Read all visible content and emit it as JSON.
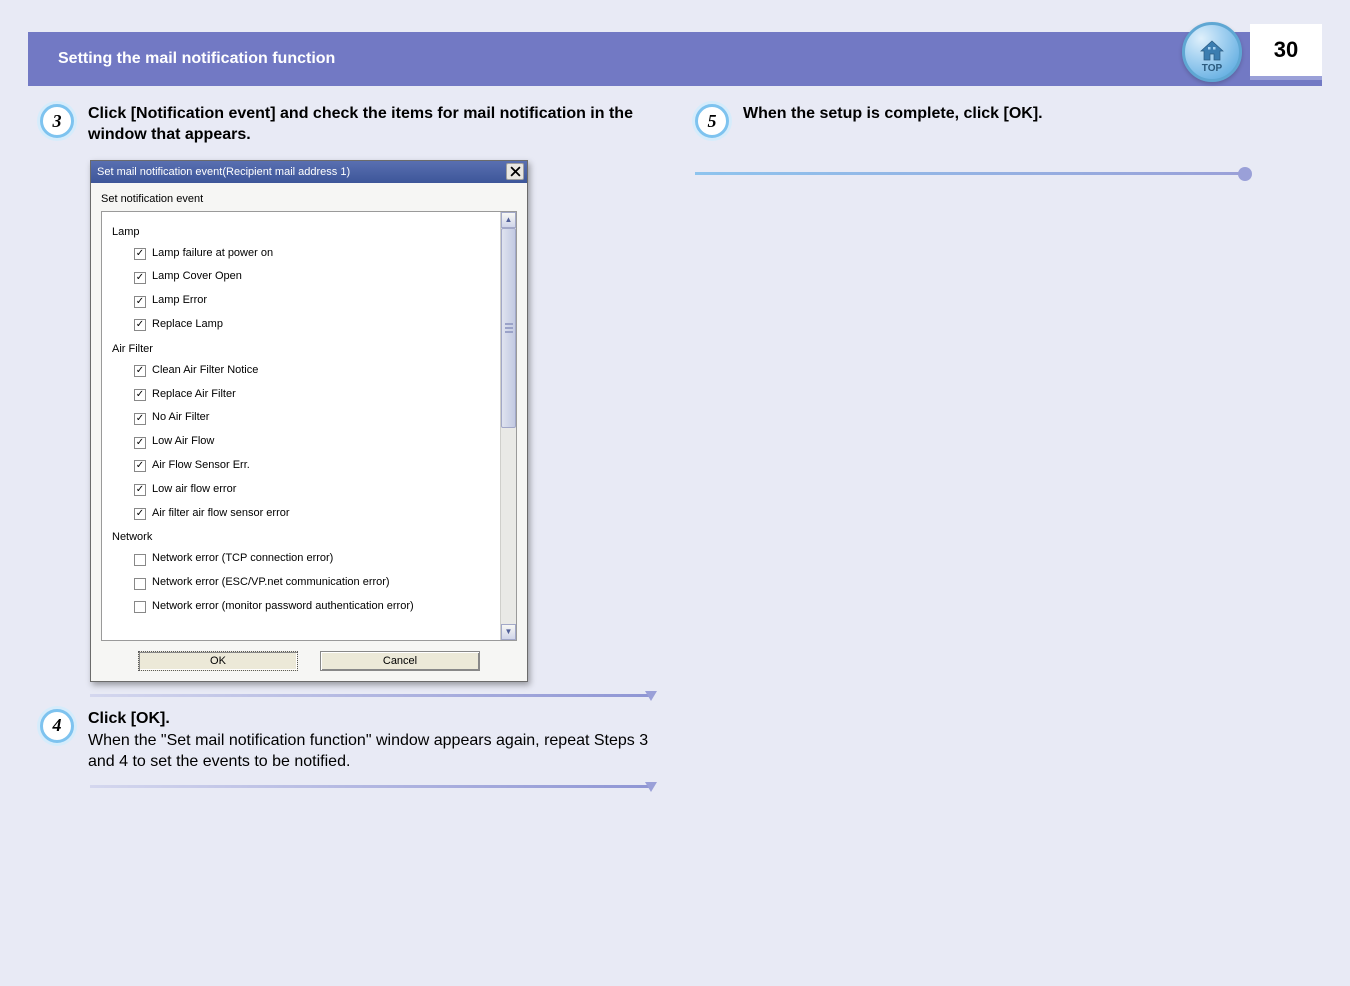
{
  "header": {
    "title": "Setting the mail notification function",
    "page_number": "30",
    "top_label": "TOP"
  },
  "left": {
    "step3": {
      "num": "3",
      "text": "Click [Notification event] and check the items for mail notification in the window that appears."
    },
    "dialog": {
      "title": "Set mail notification event(Recipient mail address 1)",
      "section_label": "Set notification event",
      "groups": [
        {
          "name": "Lamp",
          "items": [
            {
              "label": "Lamp failure at power on",
              "checked": true
            },
            {
              "label": "Lamp Cover Open",
              "checked": true
            },
            {
              "label": "Lamp Error",
              "checked": true
            },
            {
              "label": "Replace Lamp",
              "checked": true
            }
          ]
        },
        {
          "name": "Air Filter",
          "items": [
            {
              "label": "Clean Air Filter Notice",
              "checked": true
            },
            {
              "label": "Replace Air Filter",
              "checked": true
            },
            {
              "label": "No Air Filter",
              "checked": true
            },
            {
              "label": "Low Air Flow",
              "checked": true
            },
            {
              "label": "Air Flow Sensor Err.",
              "checked": true
            },
            {
              "label": "Low air flow error",
              "checked": true
            },
            {
              "label": "Air filter air flow sensor error",
              "checked": true
            }
          ]
        },
        {
          "name": "Network",
          "items": [
            {
              "label": "Network error (TCP connection error)",
              "checked": false
            },
            {
              "label": "Network error (ESC/VP.net communication error)",
              "checked": false
            },
            {
              "label": "Network error (monitor password authentication error)",
              "checked": false
            }
          ]
        }
      ],
      "ok_label": "OK",
      "cancel_label": "Cancel"
    },
    "step4": {
      "num": "4",
      "head": "Click [OK].",
      "desc": "When the \"Set mail notification function\" window appears again, repeat Steps 3 and 4 to set the events to be notified."
    }
  },
  "right": {
    "step5": {
      "num": "5",
      "text": "When the setup is complete, click [OK]."
    }
  }
}
